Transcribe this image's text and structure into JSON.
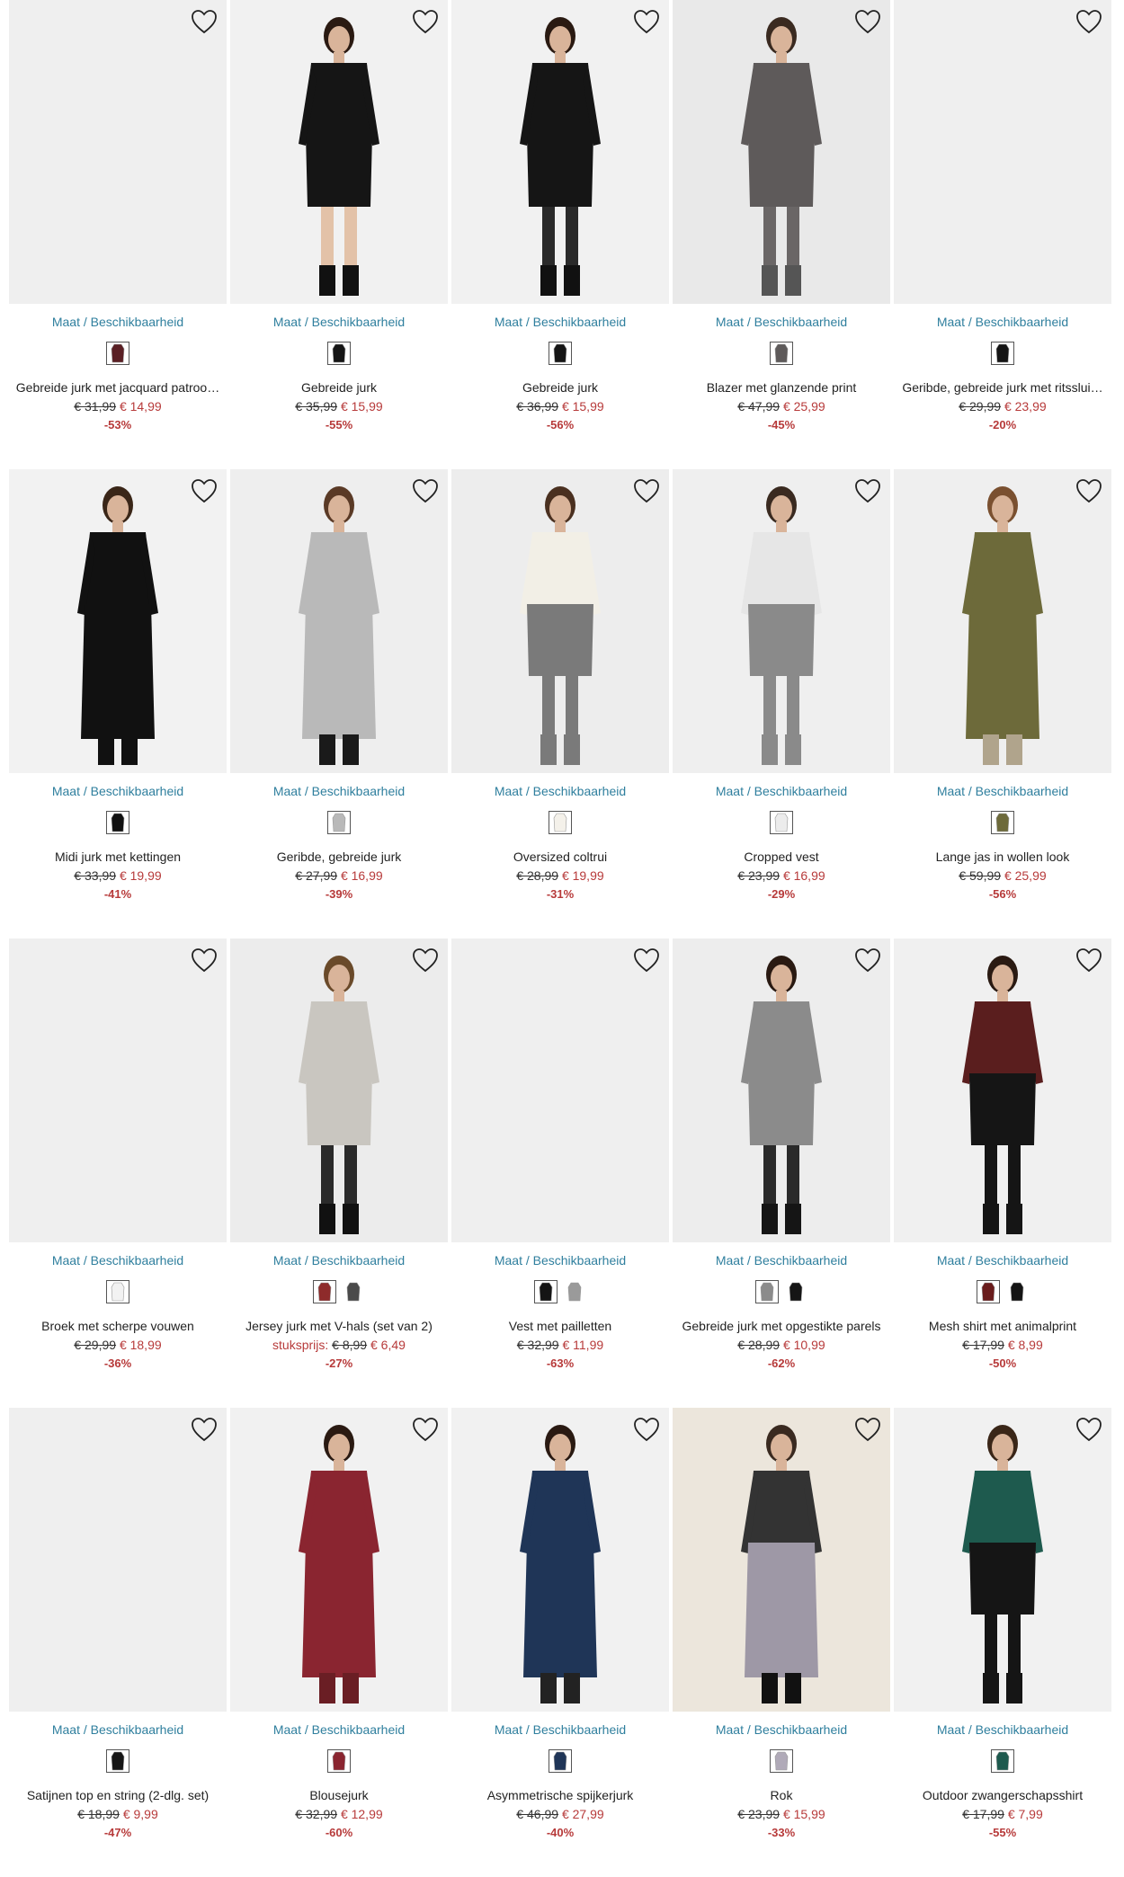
{
  "labels": {
    "size_link": "Maat / Beschikbaarheid"
  },
  "colors": {
    "link": "#2f7f9e",
    "sale": "#b73a3a"
  },
  "products": [
    {
      "title": "Gebreide jurk met jacquard patroo…",
      "old": "€ 31,99",
      "new": "€ 14,99",
      "discount": "-53%",
      "unit_label": "",
      "image": "blank",
      "figure": null,
      "swatches": [
        "#5a1f24"
      ]
    },
    {
      "title": "Gebreide jurk",
      "old": "€ 35,99",
      "new": "€ 15,99",
      "discount": "-55%",
      "unit_label": "",
      "image": "model",
      "figure": {
        "top": "#151515",
        "bottom": "#151515",
        "legs": "#e3c2a8",
        "boots": "#111111",
        "hair": "#2a1a12",
        "bg": "#f1f1f1",
        "long": false
      },
      "swatches": [
        "#151515"
      ]
    },
    {
      "title": "Gebreide jurk",
      "old": "€ 36,99",
      "new": "€ 15,99",
      "discount": "-56%",
      "unit_label": "",
      "image": "model",
      "figure": {
        "top": "#151515",
        "bottom": "#151515",
        "legs": "#2a2a2a",
        "boots": "#111111",
        "hair": "#2a1a12",
        "bg": "#f1f1f1",
        "long": false
      },
      "swatches": [
        "#151515"
      ]
    },
    {
      "title": "Blazer met glanzende print",
      "old": "€ 47,99",
      "new": "€ 25,99",
      "discount": "-45%",
      "unit_label": "",
      "image": "model",
      "figure": {
        "top": "#5e5a5a",
        "bottom": "#5e5a5a",
        "legs": "#6a6666",
        "boots": "#555",
        "hair": "#3a2a20",
        "bg": "#e9e9e9",
        "long": false
      },
      "swatches": [
        "#5e5a5a"
      ]
    },
    {
      "title": "Geribde, gebreide jurk met ritsslui…",
      "old": "€ 29,99",
      "new": "€ 23,99",
      "discount": "-20%",
      "unit_label": "",
      "image": "blank",
      "figure": null,
      "swatches": [
        "#151515"
      ]
    },
    {
      "title": "Midi jurk met kettingen",
      "old": "€ 33,99",
      "new": "€ 19,99",
      "discount": "-41%",
      "unit_label": "",
      "image": "model",
      "figure": {
        "top": "#111111",
        "bottom": "#111111",
        "legs": "#e0bfa4",
        "boots": "#111111",
        "hair": "#3a2618",
        "bg": "#f2f2f2",
        "long": true
      },
      "swatches": [
        "#111111"
      ]
    },
    {
      "title": "Geribde, gebreide jurk",
      "old": "€ 27,99",
      "new": "€ 16,99",
      "discount": "-39%",
      "unit_label": "",
      "image": "model",
      "figure": {
        "top": "#b9b9b9",
        "bottom": "#b9b9b9",
        "legs": "#b9b9b9",
        "boots": "#1a1a1a",
        "hair": "#5a3a26",
        "bg": "#eeeeee",
        "long": true
      },
      "swatches": [
        "#b9b9b9"
      ]
    },
    {
      "title": "Oversized coltrui",
      "old": "€ 28,99",
      "new": "€ 19,99",
      "discount": "-31%",
      "unit_label": "",
      "image": "model",
      "figure": {
        "top": "#f2efe6",
        "bottom": "#7a7a7a",
        "legs": "#7a7a7a",
        "boots": "#7a7a7a",
        "hair": "#4a3020",
        "bg": "#ededed",
        "long": false
      },
      "swatches": [
        "#f4f1ea"
      ]
    },
    {
      "title": "Cropped vest",
      "old": "€ 23,99",
      "new": "€ 16,99",
      "discount": "-29%",
      "unit_label": "",
      "image": "model",
      "figure": {
        "top": "#e6e6e6",
        "bottom": "#8a8a8a",
        "legs": "#8a8a8a",
        "boots": "#8a8a8a",
        "hair": "#3a2a20",
        "bg": "#efefef",
        "long": false
      },
      "swatches": [
        "#ececec"
      ]
    },
    {
      "title": "Lange jas in wollen look",
      "old": "€ 59,99",
      "new": "€ 25,99",
      "discount": "-56%",
      "unit_label": "",
      "image": "model",
      "figure": {
        "top": "#6d6a3a",
        "bottom": "#6d6a3a",
        "legs": "#6f6f6f",
        "boots": "#b0a48c",
        "hair": "#7a5030",
        "bg": "#efefef",
        "long": true
      },
      "swatches": [
        "#6d6a3a"
      ]
    },
    {
      "title": "Broek met scherpe vouwen",
      "old": "€ 29,99",
      "new": "€ 18,99",
      "discount": "-36%",
      "unit_label": "",
      "image": "blank",
      "figure": null,
      "swatches": [
        "#f2f2f2"
      ]
    },
    {
      "title": "Jersey jurk met V-hals (set van 2)",
      "old": "€ 8,99",
      "new": "€ 6,49",
      "discount": "-27%",
      "unit_label": "stuksprijs:",
      "image": "model",
      "figure": {
        "top": "#c9c6c0",
        "bottom": "#c9c6c0",
        "legs": "#2a2a2a",
        "boots": "#111111",
        "hair": "#6a4a2a",
        "bg": "#ececec",
        "long": false
      },
      "swatches": [
        "#8e2b2b",
        "#4a4a4a"
      ]
    },
    {
      "title": "Vest met pailletten",
      "old": "€ 32,99",
      "new": "€ 11,99",
      "discount": "-63%",
      "unit_label": "",
      "image": "blank",
      "figure": null,
      "swatches": [
        "#151515",
        "#9a9a9a"
      ]
    },
    {
      "title": "Gebreide jurk met opgestikte parels",
      "old": "€ 28,99",
      "new": "€ 10,99",
      "discount": "-62%",
      "unit_label": "",
      "image": "model",
      "figure": {
        "top": "#8b8b8b",
        "bottom": "#8b8b8b",
        "legs": "#2a2a2a",
        "boots": "#151515",
        "hair": "#2a1a12",
        "bg": "#ededed",
        "long": false
      },
      "swatches": [
        "#8b8b8b",
        "#151515"
      ]
    },
    {
      "title": "Mesh shirt met animalprint",
      "old": "€ 17,99",
      "new": "€ 8,99",
      "discount": "-50%",
      "unit_label": "",
      "image": "model",
      "figure": {
        "top": "#5a1e1e",
        "bottom": "#151515",
        "legs": "#151515",
        "boots": "#151515",
        "hair": "#2a1a12",
        "bg": "#f0f0f0",
        "long": false
      },
      "swatches": [
        "#6a1c1c",
        "#151515"
      ]
    },
    {
      "title": "Satijnen top en string (2-dlg. set)",
      "old": "€ 18,99",
      "new": "€ 9,99",
      "discount": "-47%",
      "unit_label": "",
      "image": "blank",
      "figure": null,
      "swatches": [
        "#151515"
      ]
    },
    {
      "title": "Blousejurk",
      "old": "€ 32,99",
      "new": "€ 12,99",
      "discount": "-60%",
      "unit_label": "",
      "image": "model",
      "figure": {
        "top": "#8a2530",
        "bottom": "#8a2530",
        "legs": "#6a1e24",
        "boots": "#6a1e24",
        "hair": "#2a1a12",
        "bg": "#f1f1f1",
        "long": true
      },
      "swatches": [
        "#8a2530"
      ]
    },
    {
      "title": "Asymmetrische spijkerjurk",
      "old": "€ 46,99",
      "new": "€ 27,99",
      "discount": "-40%",
      "unit_label": "",
      "image": "model",
      "figure": {
        "top": "#1f3557",
        "bottom": "#1f3557",
        "legs": "#e8e8e8",
        "boots": "#222222",
        "hair": "#2a1a12",
        "bg": "#f1f1f1",
        "long": true
      },
      "swatches": [
        "#1f3557"
      ]
    },
    {
      "title": "Rok",
      "old": "€ 23,99",
      "new": "€ 15,99",
      "discount": "-33%",
      "unit_label": "",
      "image": "model",
      "figure": {
        "top": "#333333",
        "bottom": "#9e98a6",
        "legs": "#e0bfa4",
        "boots": "#111111",
        "hair": "#3a2a20",
        "bg": "#ece6dc",
        "long": true
      },
      "swatches": [
        "#b0aab8"
      ]
    },
    {
      "title": "Outdoor zwangerschapsshirt",
      "old": "€ 17,99",
      "new": "€ 7,99",
      "discount": "-55%",
      "unit_label": "",
      "image": "model",
      "figure": {
        "top": "#1e5a4e",
        "bottom": "#151515",
        "legs": "#151515",
        "boots": "#151515",
        "hair": "#3a2618",
        "bg": "#f1f1f1",
        "long": false
      },
      "swatches": [
        "#1e5a4e"
      ]
    }
  ]
}
